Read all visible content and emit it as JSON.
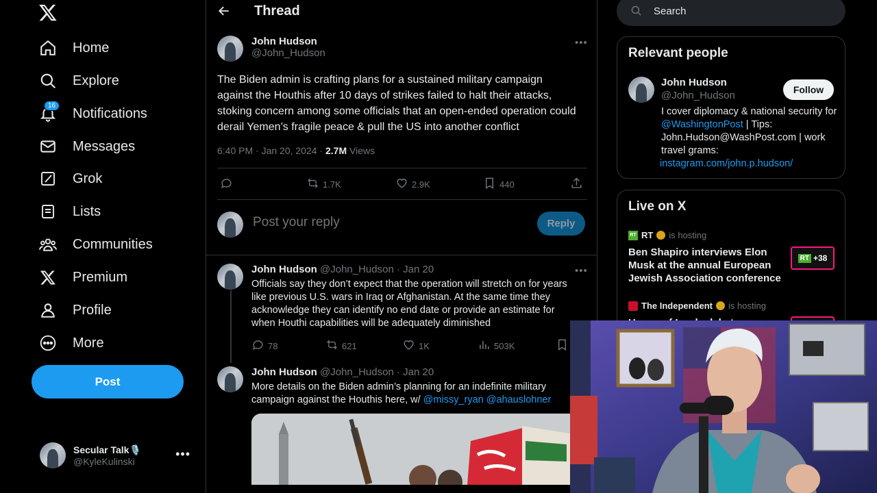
{
  "nav": {
    "items": [
      {
        "label": "Home",
        "icon": "home-icon"
      },
      {
        "label": "Explore",
        "icon": "search-icon"
      },
      {
        "label": "Notifications",
        "icon": "bell-icon",
        "badge": "16"
      },
      {
        "label": "Messages",
        "icon": "mail-icon"
      },
      {
        "label": "Grok",
        "icon": "grok-icon"
      },
      {
        "label": "Lists",
        "icon": "list-icon"
      },
      {
        "label": "Communities",
        "icon": "communities-icon"
      },
      {
        "label": "Premium",
        "icon": "x-logo-icon"
      },
      {
        "label": "Profile",
        "icon": "person-icon"
      },
      {
        "label": "More",
        "icon": "more-circle-icon"
      }
    ],
    "post_label": "Post",
    "account": {
      "name": "Secular Talk🎙️",
      "handle": "@KyleKulinski"
    }
  },
  "thread": {
    "title": "Thread",
    "main": {
      "name": "John Hudson",
      "handle": "@John_Hudson",
      "text": "The Biden admin is crafting plans for a sustained military campaign against the Houthis after 10 days of strikes failed to halt their attacks, stoking concern among some officials that an open-ended operation could derail Yemen’s fragile peace & pull the US into another conflict",
      "time": "6:40 PM · Jan 20, 2024 · ",
      "views_count": "2.7M",
      "views_label": " Views",
      "reposts": "1.7K",
      "likes": "2.9K",
      "bookmarks": "440"
    },
    "reply_placeholder": "Post your reply",
    "reply_button": "Reply",
    "replies": [
      {
        "name": "John Hudson",
        "meta": " @John_Hudson · Jan 20",
        "text": "Officials say they don’t expect that the operation will stretch on for years like previous U.S. wars in Iraq or Afghanistan. At the same time they acknowledge they can identify no end date or provide an estimate for when Houthi capabilities will be adequately diminished",
        "replies": "78",
        "reposts": "621",
        "likes": "1K",
        "views": "503K"
      },
      {
        "name": "John Hudson",
        "meta": " @John_Hudson · Jan 20",
        "text": "More details on the Biden admin’s planning for an indefinite military campaign against the Houthis here, w/ ",
        "mentions": "@missy_ryan @ahauslohner"
      }
    ]
  },
  "right": {
    "search_placeholder": "Search",
    "relevant": {
      "title": "Relevant people",
      "name": "John Hudson",
      "handle": "@John_Hudson",
      "follow": "Follow",
      "bio_1": "I cover diplomacy & national security for ",
      "bio_mention": "@WashingtonPost",
      "bio_2": " | Tips: John.Hudson@WashPost.com | work travel grams:",
      "bio_link": "instagram.com/john.p.hudson/"
    },
    "live": {
      "title": "Live on X",
      "items": [
        {
          "host": "RT",
          "hosting": "is hosting",
          "title": "Ben Shapiro interviews Elon Musk at the annual European Jewish Association conference",
          "count": "+38"
        },
        {
          "host": "The Independent",
          "hosting": "is hosting",
          "title": "House of Lords debates Rwanda"
        }
      ]
    }
  },
  "colors": {
    "accent": "#1d9bf0",
    "background": "#000000",
    "border": "#2f3336",
    "muted": "#71767b",
    "live": "#f91880"
  }
}
